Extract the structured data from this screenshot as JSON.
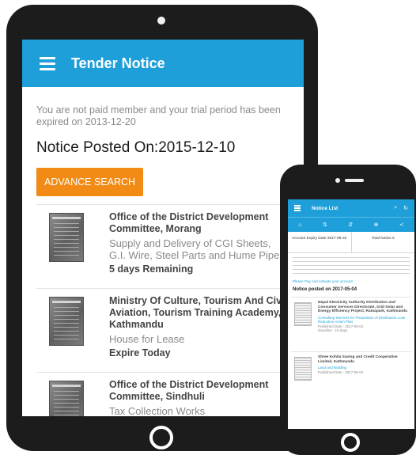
{
  "tablet": {
    "app_title": "Tender Notice",
    "warning": "You are not paid member and your trial period has been expired on 2013-12-20",
    "notice_posted": "Notice Posted On:2015-12-10",
    "advance_search_label": "ADVANCE SEARCH",
    "items": [
      {
        "org_line1": "Office of the District Development",
        "org_line2": "Committee, Morang",
        "org_line3": "",
        "desc_line1": "Supply and Delivery of CGI Sheets,",
        "desc_line2": "G.I. Wire, Steel Parts and Hume Pipe",
        "remaining": "5 days Remaining"
      },
      {
        "org_line1": "Ministry Of Culture, Tourism And Civil",
        "org_line2": "Aviation, Tourism Training Academy,",
        "org_line3": "Kathmandu",
        "desc_line1": "House for Lease",
        "desc_line2": "",
        "remaining": "Expire Today"
      },
      {
        "org_line1": "Office of the District Development",
        "org_line2": "Committee, Sindhuli",
        "org_line3": "",
        "desc_line1": "Tax Collection Works",
        "desc_line2": "",
        "remaining": ""
      }
    ]
  },
  "phone": {
    "app_title": "Notice List",
    "account_expiry": "Account Expiry Date 2017-05-22",
    "total_notice": "Total Notice 5",
    "warning_link": "Please Pay And Activate your account",
    "notice_posted": "Notice posted on 2017-05-04",
    "items": [
      {
        "org": "Nepal Electricity Authority Distribution and Consumer Services Directorate, Grid Solar and Energy Efficiency Project, Ratnapark, Kathmandu",
        "desc": "Consulting Services for Preparation of Distribution Loss Reduction Action Plan",
        "published": "Published Date : 2017-05-04",
        "deadline": "Deadline : 10 days"
      },
      {
        "org": "Shree Kohila Saving and Credit Cooperative Limited, Kathmandu",
        "desc": "Land and Building",
        "published": "Published Date : 2017-05-04",
        "deadline": ""
      }
    ]
  },
  "colors": {
    "app_bar": "#1e9fd9",
    "advance_search": "#f18b16",
    "device_body": "#1c1c1c"
  }
}
